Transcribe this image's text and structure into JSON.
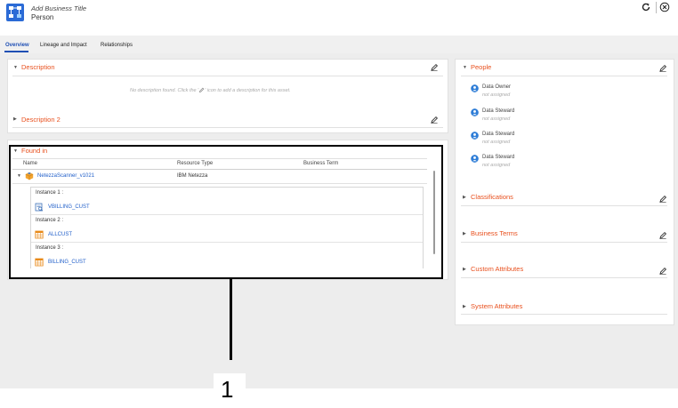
{
  "header": {
    "title": "Add Business Title",
    "asset_type": "Person",
    "asset_icon": "data-structure-icon",
    "refresh_icon": "refresh-icon",
    "close_icon": "close-circle-icon"
  },
  "tabs": [
    {
      "label": "Overview",
      "active": true
    },
    {
      "label": "Lineage and Impact",
      "active": false
    },
    {
      "label": "Relationships",
      "active": false
    }
  ],
  "description": {
    "title": "Description",
    "empty_text_before": "No description found. Click the '",
    "empty_text_after": "' icon to add a description for this asset."
  },
  "description2": {
    "title": "Description 2"
  },
  "found_in": {
    "title": "Found in",
    "columns": [
      "Name",
      "Resource Type",
      "Business Term"
    ],
    "resource": {
      "name": "NetezzaScanner_v1021",
      "resource_type": "IBM Netezza",
      "business_term": ""
    },
    "instances": [
      {
        "label": "Instance 1 :",
        "object": "VBILLING_CUST",
        "icon": "view-icon"
      },
      {
        "label": "Instance 2 :",
        "object": "ALLCUST",
        "icon": "table-icon"
      },
      {
        "label": "Instance 3 :",
        "object": "BILLING_CUST",
        "icon": "table-icon"
      }
    ]
  },
  "people": {
    "title": "People",
    "entries": [
      {
        "role": "Data Owner",
        "value": "not assigned"
      },
      {
        "role": "Data Steward",
        "value": "not assigned"
      },
      {
        "role": "Data Steward",
        "value": "not assigned"
      },
      {
        "role": "Data Steward",
        "value": "not assigned"
      }
    ]
  },
  "side_sections": [
    {
      "title": "Classifications",
      "editable": true
    },
    {
      "title": "Business Terms",
      "editable": true
    },
    {
      "title": "Custom Attributes",
      "editable": true
    },
    {
      "title": "System Attributes",
      "editable": false
    }
  ],
  "callout": {
    "number": "1"
  },
  "colors": {
    "accent": "#e8501e",
    "link": "#1f5ec9",
    "tab_active": "#1f4fb4",
    "avatar": "#2e7dd7"
  }
}
